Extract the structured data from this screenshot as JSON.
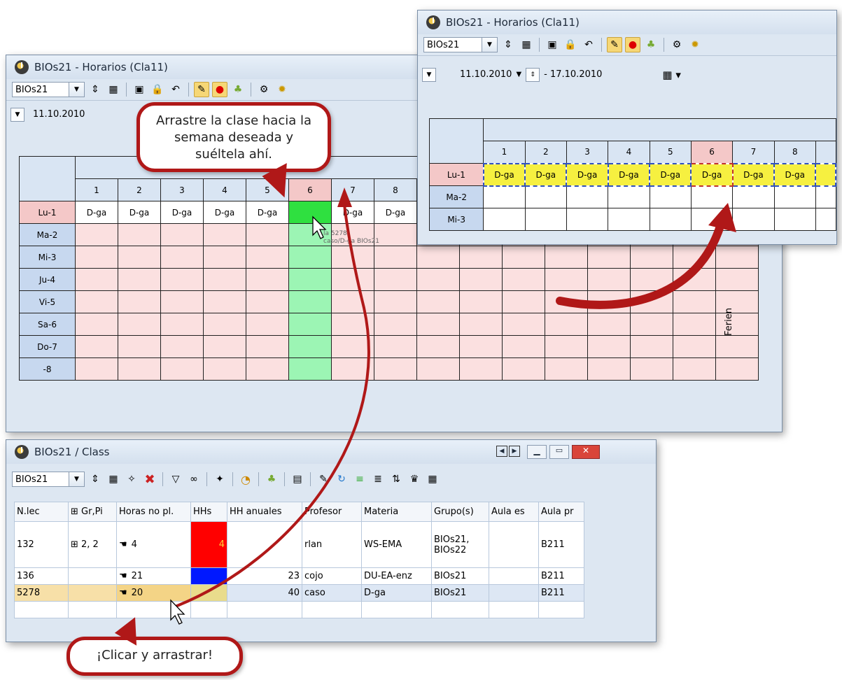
{
  "window_left": {
    "title": "BIOs21 -  Horarios  (Cla11)",
    "class_combo": "BIOs21",
    "date_from": "11.10.2010",
    "columns": [
      "1",
      "2",
      "3",
      "4",
      "5",
      "6",
      "7",
      "8"
    ],
    "rows": [
      "Lu-1",
      "Ma-2",
      "Mi-3",
      "Ju-4",
      "Vi-5",
      "Sa-6",
      "Do-7",
      "-8"
    ],
    "lesson": "D-ga",
    "drag_ghost": [
      "la 5278",
      "caso/D-ga BIOs21"
    ],
    "holiday_label": "Ferien"
  },
  "window_right": {
    "title": "BIOs21 -  Horarios  (Cla11)",
    "class_combo": "BIOs21",
    "date_from": "11.10.2010",
    "date_to": "- 17.10.2010",
    "columns": [
      "1",
      "2",
      "3",
      "4",
      "5",
      "6",
      "7",
      "8"
    ],
    "rows": [
      "Lu-1",
      "Ma-2",
      "Mi-3"
    ],
    "lesson": "D-ga"
  },
  "window_bottom": {
    "title": "BIOs21 / Class",
    "class_combo": "BIOs21",
    "headers": [
      "N.lec",
      "⊞ Gr,Pi",
      "Horas no pl.",
      "HHs",
      "HH anuales",
      "Profesor",
      "Materia",
      "Grupo(s)",
      "Aula es",
      "Aula pr"
    ],
    "rows": [
      {
        "nlec": "132",
        "gr": "⊞ 2, 2",
        "horas": "4",
        "hhs": "4",
        "hh_anuales": "",
        "profesor": "rlan",
        "materia": "WS-EMA",
        "grupos": "BIOs21, BIOs22",
        "aula_es": "",
        "aula_pr": "B211"
      },
      {
        "nlec": "136",
        "gr": "",
        "horas": "21",
        "hhs": "",
        "hh_anuales": "23",
        "profesor": "cojo",
        "materia": "DU-EA-enz",
        "grupos": "BIOs21",
        "aula_es": "",
        "aula_pr": "B211"
      },
      {
        "nlec": "5278",
        "gr": "",
        "horas": "20",
        "hhs": "",
        "hh_anuales": "40",
        "profesor": "caso",
        "materia": "D-ga",
        "grupos": "BIOs21",
        "aula_es": "",
        "aula_pr": "B211"
      }
    ]
  },
  "callouts": {
    "drag_to_week": "Arrastre la clase hacia la semana deseada y suéltela ahí.",
    "click_drag": "¡Clicar y arrastrar!"
  },
  "colors": {
    "accent_red": "#b01818",
    "pink": "#fbe0e0",
    "green": "#9cf5b4",
    "dashed_yellow": "#f6f040"
  }
}
